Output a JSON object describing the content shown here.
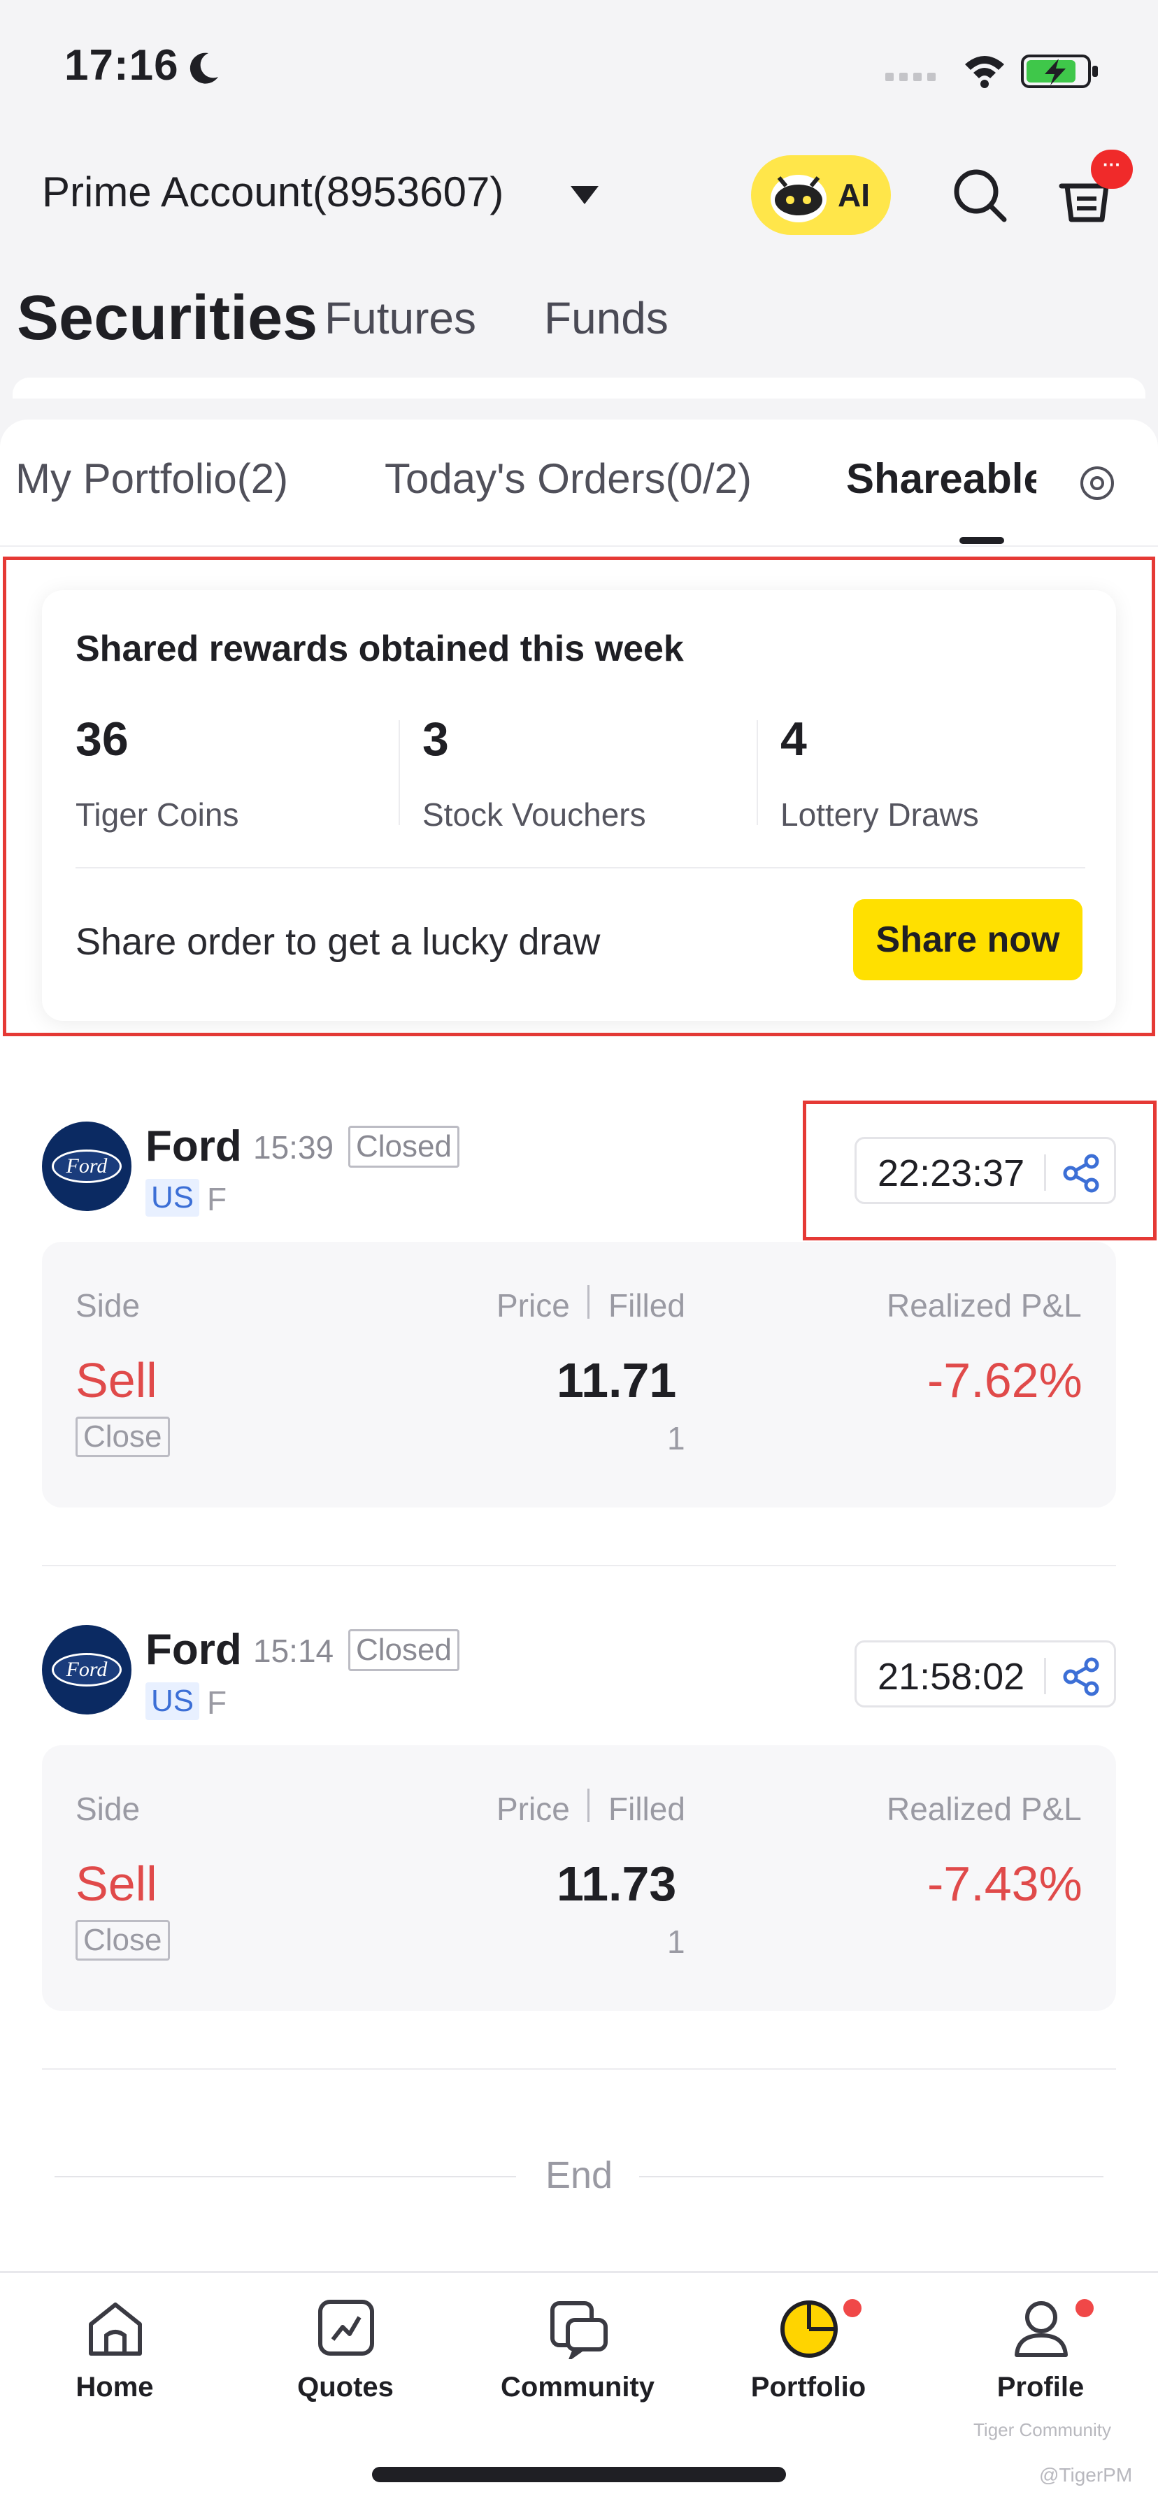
{
  "status_bar": {
    "time": "17:16"
  },
  "header": {
    "account": "Prime Account(8953607)",
    "ai_label": "AI",
    "badge": "···"
  },
  "categories": [
    {
      "label": "Securities"
    },
    {
      "label": "Futures"
    },
    {
      "label": "Funds"
    }
  ],
  "subtabs": [
    {
      "label": "My Portfolio(2)"
    },
    {
      "label": "Today's Orders(0/2)"
    },
    {
      "label": "Shareable"
    }
  ],
  "rewards": {
    "title": "Shared rewards obtained this week",
    "items": [
      {
        "value": "36",
        "label": "Tiger Coins"
      },
      {
        "value": "3",
        "label": "Stock Vouchers"
      },
      {
        "value": "4",
        "label": "Lottery Draws"
      }
    ],
    "share_text": "Share order to get a lucky draw",
    "share_button": "Share now"
  },
  "orders": [
    {
      "name": "Ford",
      "time": "15:39",
      "status": "Closed",
      "market": "US",
      "ticker": "F",
      "countdown": "22:23:37",
      "side_header": "Side",
      "price_header": "Price",
      "filled_header": "Filled",
      "pl_header": "Realized P&L",
      "side": "Sell",
      "action": "Close",
      "price": "11.71",
      "filled": "1",
      "pl": "-7.62%"
    },
    {
      "name": "Ford",
      "time": "15:14",
      "status": "Closed",
      "market": "US",
      "ticker": "F",
      "countdown": "21:58:02",
      "side_header": "Side",
      "price_header": "Price",
      "filled_header": "Filled",
      "pl_header": "Realized P&L",
      "side": "Sell",
      "action": "Close",
      "price": "11.73",
      "filled": "1",
      "pl": "-7.43%"
    }
  ],
  "end_text": "End",
  "nav": [
    {
      "label": "Home",
      "icon": "home-icon"
    },
    {
      "label": "Quotes",
      "icon": "chart-icon"
    },
    {
      "label": "Community",
      "icon": "community-icon"
    },
    {
      "label": "Portfolio",
      "icon": "pie-chart-icon"
    },
    {
      "label": "Profile",
      "icon": "profile-icon"
    }
  ],
  "watermark": {
    "line1": "Tiger Community",
    "line2": "@TigerPM"
  },
  "logo_text": "Ford",
  "colors": {
    "accent": "#ffe000",
    "loss": "#e04a4a",
    "badge": "#f02a2a",
    "market": "#3c6fd6"
  }
}
